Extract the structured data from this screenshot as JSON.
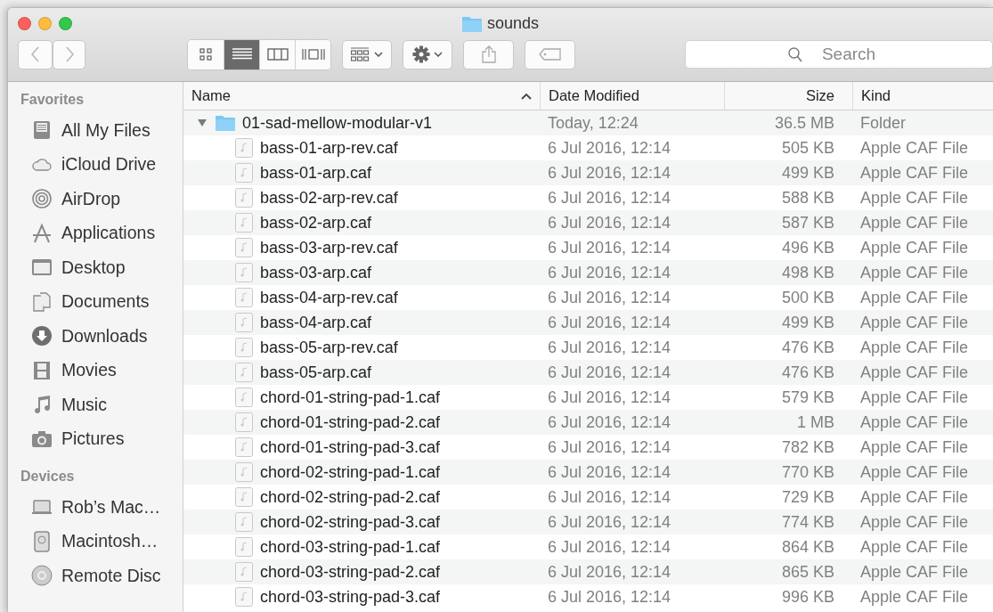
{
  "window": {
    "title": "sounds"
  },
  "toolbar": {
    "view_modes": [
      {
        "kind": "icons",
        "selected": false
      },
      {
        "kind": "list",
        "selected": true
      },
      {
        "kind": "columns",
        "selected": false
      },
      {
        "kind": "coverflow",
        "selected": false
      }
    ],
    "search": {
      "placeholder": "Search"
    }
  },
  "sidebar": {
    "sections": [
      {
        "title": "Favorites",
        "items": [
          {
            "label": "All My Files",
            "kind": "files"
          },
          {
            "label": "iCloud Drive",
            "kind": "cloud"
          },
          {
            "label": "AirDrop",
            "kind": "airdrop"
          },
          {
            "label": "Applications",
            "kind": "apps"
          },
          {
            "label": "Desktop",
            "kind": "desktop"
          },
          {
            "label": "Documents",
            "kind": "documents"
          },
          {
            "label": "Downloads",
            "kind": "downloads"
          },
          {
            "label": "Movies",
            "kind": "movies"
          },
          {
            "label": "Music",
            "kind": "music"
          },
          {
            "label": "Pictures",
            "kind": "pictures"
          }
        ]
      },
      {
        "title": "Devices",
        "items": [
          {
            "label": "Rob’s Mac…",
            "kind": "laptop"
          },
          {
            "label": "Macintosh…",
            "kind": "disk"
          },
          {
            "label": "Remote Disc",
            "kind": "disc"
          }
        ]
      }
    ]
  },
  "table": {
    "columns": [
      {
        "label": "Name",
        "sorted": true
      },
      {
        "label": "Date Modified",
        "sorted": false
      },
      {
        "label": "Size",
        "sorted": false
      },
      {
        "label": "Kind",
        "sorted": false
      }
    ],
    "rows": [
      {
        "name": "01-sad-mellow-modular-v1",
        "date": "Today, 12:24",
        "size": "36.5 MB",
        "kind_label": "Folder",
        "kind": "folder",
        "expanded": true,
        "children": [
          {
            "name": "bass-01-arp-rev.caf",
            "date": "6 Jul 2016, 12:14",
            "size": "505 KB",
            "kind_label": "Apple CAF File",
            "kind": "file"
          },
          {
            "name": "bass-01-arp.caf",
            "date": "6 Jul 2016, 12:14",
            "size": "499 KB",
            "kind_label": "Apple CAF File",
            "kind": "file"
          },
          {
            "name": "bass-02-arp-rev.caf",
            "date": "6 Jul 2016, 12:14",
            "size": "588 KB",
            "kind_label": "Apple CAF File",
            "kind": "file"
          },
          {
            "name": "bass-02-arp.caf",
            "date": "6 Jul 2016, 12:14",
            "size": "587 KB",
            "kind_label": "Apple CAF File",
            "kind": "file"
          },
          {
            "name": "bass-03-arp-rev.caf",
            "date": "6 Jul 2016, 12:14",
            "size": "496 KB",
            "kind_label": "Apple CAF File",
            "kind": "file"
          },
          {
            "name": "bass-03-arp.caf",
            "date": "6 Jul 2016, 12:14",
            "size": "498 KB",
            "kind_label": "Apple CAF File",
            "kind": "file"
          },
          {
            "name": "bass-04-arp-rev.caf",
            "date": "6 Jul 2016, 12:14",
            "size": "500 KB",
            "kind_label": "Apple CAF File",
            "kind": "file"
          },
          {
            "name": "bass-04-arp.caf",
            "date": "6 Jul 2016, 12:14",
            "size": "499 KB",
            "kind_label": "Apple CAF File",
            "kind": "file"
          },
          {
            "name": "bass-05-arp-rev.caf",
            "date": "6 Jul 2016, 12:14",
            "size": "476 KB",
            "kind_label": "Apple CAF File",
            "kind": "file"
          },
          {
            "name": "bass-05-arp.caf",
            "date": "6 Jul 2016, 12:14",
            "size": "476 KB",
            "kind_label": "Apple CAF File",
            "kind": "file"
          },
          {
            "name": "chord-01-string-pad-1.caf",
            "date": "6 Jul 2016, 12:14",
            "size": "579 KB",
            "kind_label": "Apple CAF File",
            "kind": "file"
          },
          {
            "name": "chord-01-string-pad-2.caf",
            "date": "6 Jul 2016, 12:14",
            "size": "1 MB",
            "kind_label": "Apple CAF File",
            "kind": "file"
          },
          {
            "name": "chord-01-string-pad-3.caf",
            "date": "6 Jul 2016, 12:14",
            "size": "782 KB",
            "kind_label": "Apple CAF File",
            "kind": "file"
          },
          {
            "name": "chord-02-string-pad-1.caf",
            "date": "6 Jul 2016, 12:14",
            "size": "770 KB",
            "kind_label": "Apple CAF File",
            "kind": "file"
          },
          {
            "name": "chord-02-string-pad-2.caf",
            "date": "6 Jul 2016, 12:14",
            "size": "729 KB",
            "kind_label": "Apple CAF File",
            "kind": "file"
          },
          {
            "name": "chord-02-string-pad-3.caf",
            "date": "6 Jul 2016, 12:14",
            "size": "774 KB",
            "kind_label": "Apple CAF File",
            "kind": "file"
          },
          {
            "name": "chord-03-string-pad-1.caf",
            "date": "6 Jul 2016, 12:14",
            "size": "864 KB",
            "kind_label": "Apple CAF File",
            "kind": "file"
          },
          {
            "name": "chord-03-string-pad-2.caf",
            "date": "6 Jul 2016, 12:14",
            "size": "865 KB",
            "kind_label": "Apple CAF File",
            "kind": "file"
          },
          {
            "name": "chord-03-string-pad-3.caf",
            "date": "6 Jul 2016, 12:14",
            "size": "996 KB",
            "kind_label": "Apple CAF File",
            "kind": "file"
          }
        ]
      }
    ]
  }
}
